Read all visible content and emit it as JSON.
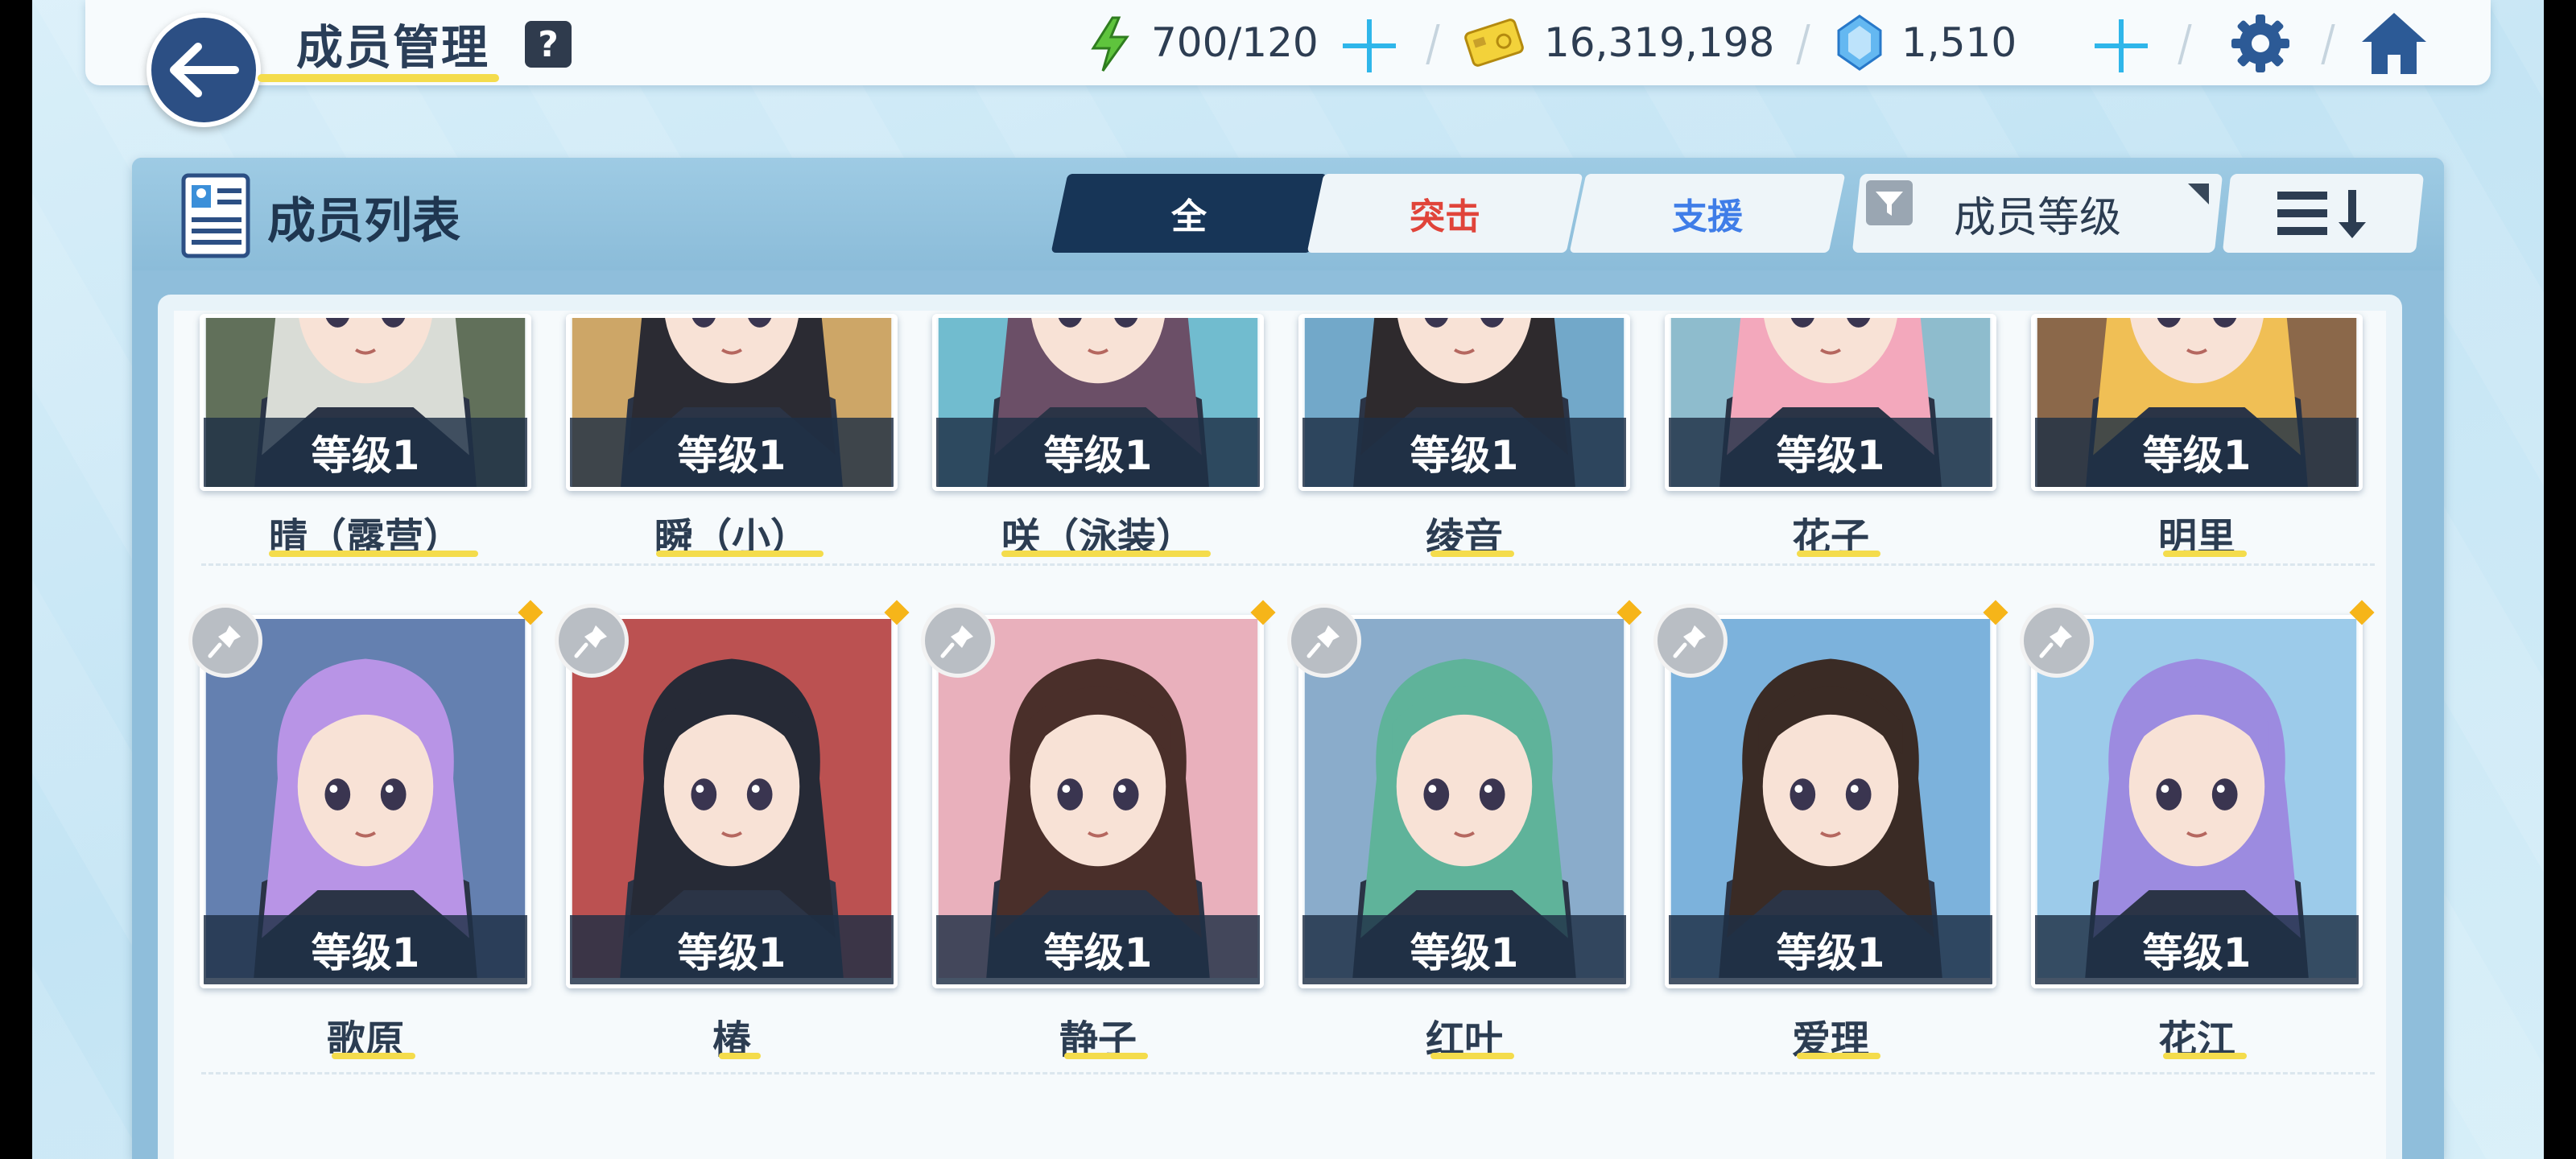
{
  "header": {
    "title": "成员管理",
    "help_label": "?",
    "stamina": "700/120",
    "credits": "16,319,198",
    "gems": "1,510"
  },
  "panel": {
    "title": "成员列表",
    "tabs": [
      {
        "label": "全",
        "active": true,
        "color": "#ffffff"
      },
      {
        "label": "突击",
        "active": false,
        "color": "#e0443a"
      },
      {
        "label": "支援",
        "active": false,
        "color": "#3f7de8"
      }
    ],
    "sort_key": "成员等级"
  },
  "members_row1": [
    {
      "name": "晴（露营）",
      "level": "等级1",
      "hair": "#d9dcd6",
      "bg": "#4c5d44"
    },
    {
      "name": "瞬（小）",
      "level": "等级1",
      "hair": "#2b2b33",
      "bg": "#c79a52"
    },
    {
      "name": "咲（泳装）",
      "level": "等级1",
      "hair": "#6b4f67",
      "bg": "#5eb3c9"
    },
    {
      "name": "绫音",
      "level": "等级1",
      "hair": "#2e2a2d",
      "bg": "#5f9cc2"
    },
    {
      "name": "花子",
      "level": "等级1",
      "hair": "#f3a8bc",
      "bg": "#7fb3c7"
    },
    {
      "name": "明里",
      "level": "等级1",
      "hair": "#f0bf55",
      "bg": "#7c5431"
    }
  ],
  "members_row2": [
    {
      "name": "歌原",
      "level": "等级1",
      "hair": "#b894e6",
      "bg": "#4f6fa6"
    },
    {
      "name": "椿",
      "level": "等级1",
      "hair": "#262a36",
      "bg": "#b23a3a"
    },
    {
      "name": "静子",
      "level": "等级1",
      "hair": "#4a2f2a",
      "bg": "#e6a5b3"
    },
    {
      "name": "红叶",
      "level": "等级1",
      "hair": "#5fb39a",
      "bg": "#7aa1c4"
    },
    {
      "name": "爱理",
      "level": "等级1",
      "hair": "#3a2b25",
      "bg": "#6aa8d8"
    },
    {
      "name": "花江",
      "level": "等级1",
      "hair": "#9c8be0",
      "bg": "#8fc4e8"
    }
  ]
}
